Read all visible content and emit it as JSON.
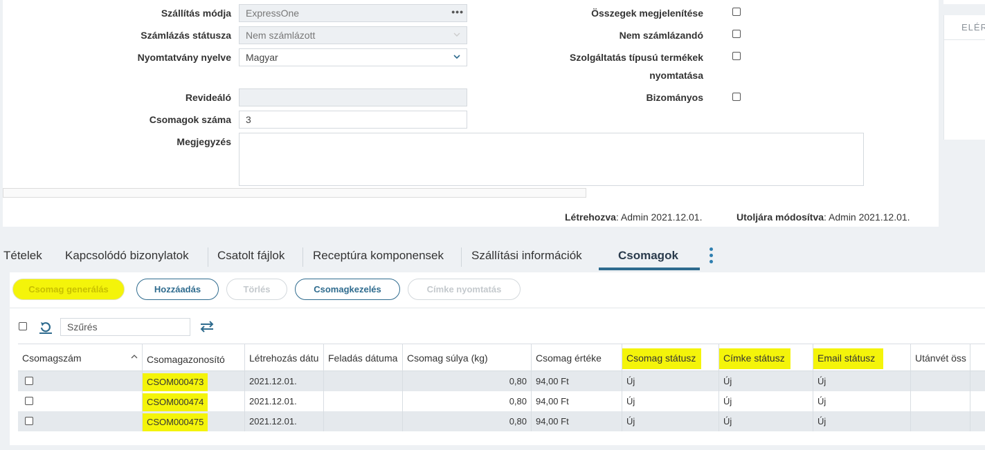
{
  "form": {
    "shipping_method": {
      "label": "Szállítás módja",
      "value": "ExpressOne"
    },
    "billing_status": {
      "label": "Számlázás státusza",
      "value": "Nem számlázott"
    },
    "print_language": {
      "label": "Nyomtatvány nyelve",
      "value": "Magyar"
    },
    "reviewer": {
      "label": "Revideáló",
      "value": ""
    },
    "package_count": {
      "label": "Csomagok száma",
      "value": "3"
    },
    "note": {
      "label": "Megjegyzés",
      "value": ""
    },
    "show_totals": {
      "label": "Összegek megjelenítése",
      "checked": false
    },
    "not_billable": {
      "label": "Nem számlázandó",
      "checked": false
    },
    "print_service_items": {
      "label_line1": "Szolgáltatás típusú termékek",
      "label_line2": "nyomtatása",
      "checked": false
    },
    "consignment": {
      "label": "Bizományos",
      "checked": false
    }
  },
  "meta": {
    "created_label": "Létrehozva",
    "created_value": ": Admin 2021.12.01.",
    "modified_label": "Utoljára módosítva",
    "modified_value": ": Admin 2021.12.01."
  },
  "side_panel": {
    "header": "ELÉR"
  },
  "tabs": [
    {
      "label": "Tételek"
    },
    {
      "label": "Kapcsolódó bizonylatok"
    },
    {
      "label": "Csatolt fájlok"
    },
    {
      "label": "Receptúra komponensek"
    },
    {
      "label": "Szállítási információk"
    },
    {
      "label": "Csomagok",
      "active": true
    }
  ],
  "actions": {
    "generate": "Csomag generálás",
    "add": "Hozzáadás",
    "delete": "Törlés",
    "manage": "Csomagkezelés",
    "print_label": "Címke nyomtatás"
  },
  "filter": {
    "placeholder": "Szűrés"
  },
  "table": {
    "columns": [
      "Csomagszám",
      "Csomagazonosító",
      "Létrehozás dátu",
      "Feladás dátuma",
      "Csomag súlya (kg)",
      "Csomag értéke",
      "Csomag státusz",
      "Címke státusz",
      "Email státusz",
      "Utánvét öss"
    ],
    "rows": [
      {
        "id": "CSOM000473",
        "created": "2021.12.01.",
        "sent": "",
        "weight": "0,80",
        "value": "94,00 Ft",
        "status": "Új",
        "label_status": "Új",
        "email_status": "Új",
        "cod": ""
      },
      {
        "id": "CSOM000474",
        "created": "2021.12.01.",
        "sent": "",
        "weight": "0,80",
        "value": "94,00 Ft",
        "status": "Új",
        "label_status": "Új",
        "email_status": "Új",
        "cod": ""
      },
      {
        "id": "CSOM000475",
        "created": "2021.12.01.",
        "sent": "",
        "weight": "0,80",
        "value": "94,00 Ft",
        "status": "Új",
        "label_status": "Új",
        "email_status": "Új",
        "cod": ""
      }
    ]
  },
  "colors": {
    "accent": "#2e6b8e",
    "highlight": "#f4f40a",
    "row_alt": "#e5e9ed"
  }
}
